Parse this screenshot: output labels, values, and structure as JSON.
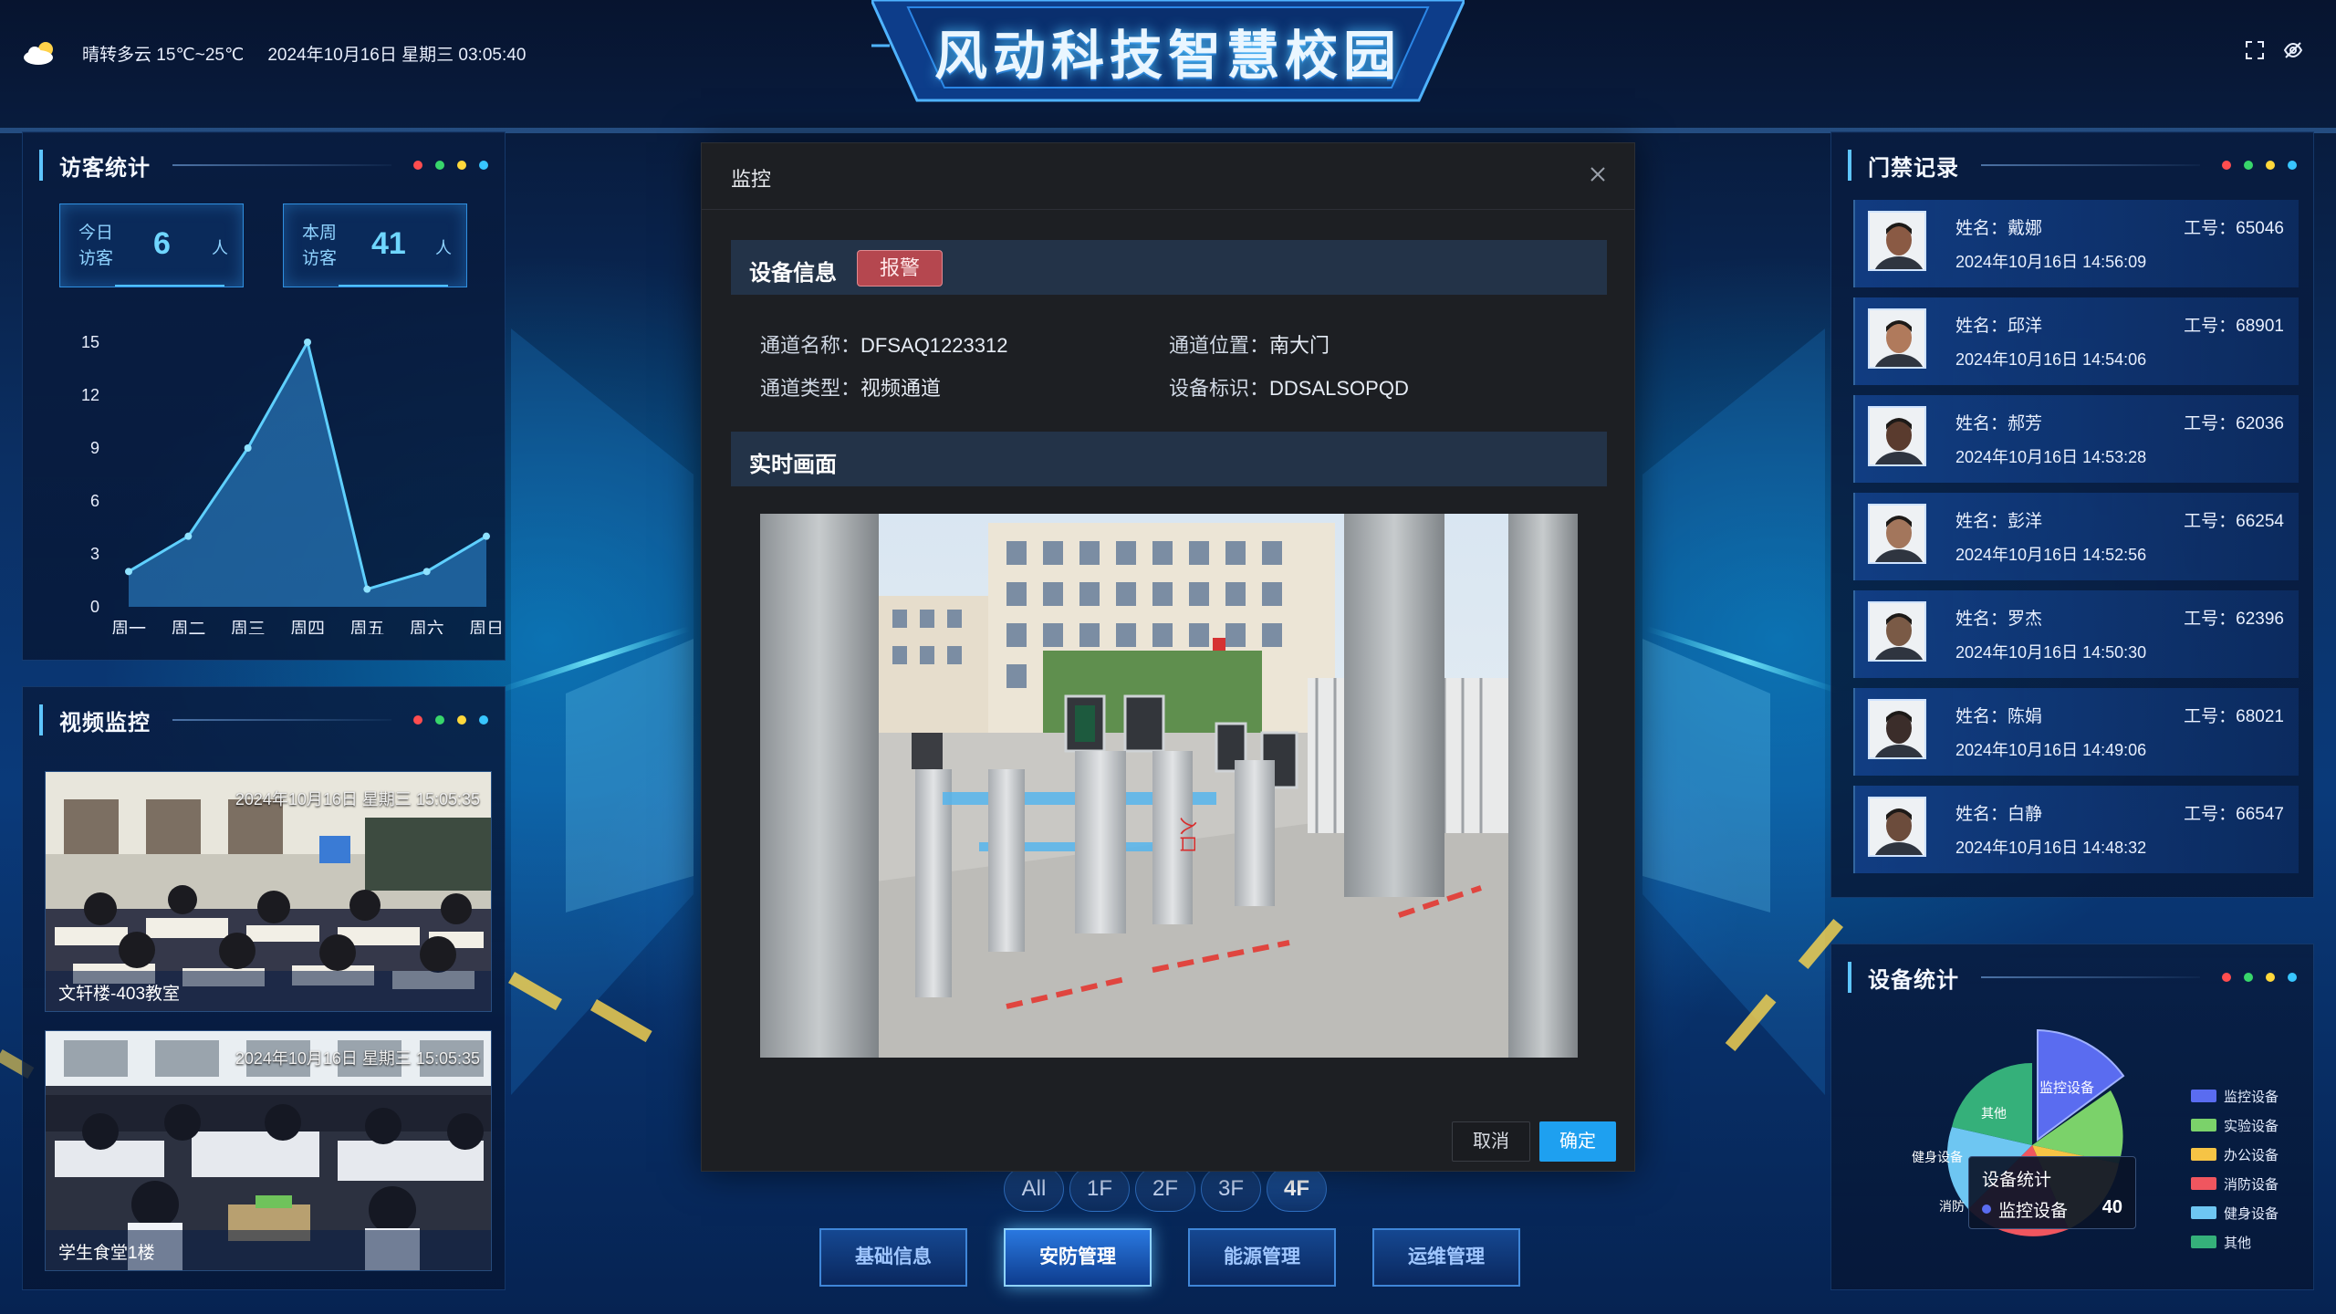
{
  "header": {
    "weather": "晴转多云 15℃~25℃",
    "datetime": "2024年10月16日 星期三 03:05:40",
    "title": "风动科技智慧校园"
  },
  "visitor_panel": {
    "title": "访客统计",
    "today": {
      "label": "今日访客",
      "value": "6",
      "unit": "人"
    },
    "week": {
      "label": "本周访客",
      "value": "41",
      "unit": "人"
    }
  },
  "chart_data": {
    "type": "area",
    "categories": [
      "周一",
      "周二",
      "周三",
      "周四",
      "周五",
      "周六",
      "周日"
    ],
    "values": [
      2,
      4,
      9,
      15,
      1,
      2,
      4
    ],
    "yticks": [
      "0",
      "3",
      "6",
      "9",
      "12",
      "15"
    ],
    "ylim": [
      0,
      15
    ],
    "title": "",
    "xlabel": "",
    "ylabel": ""
  },
  "video_panel": {
    "title": "视频监控",
    "feeds": [
      {
        "timestamp": "2024年10月16日 星期三 15:05:35",
        "caption": "文轩楼-403教室"
      },
      {
        "timestamp": "2024年10月16日 星期三 15:05:35",
        "caption": "学生食堂1楼"
      }
    ]
  },
  "access_panel": {
    "title": "门禁记录",
    "name_label": "姓名：",
    "id_label": "工号：",
    "records": [
      {
        "name": "戴娜",
        "id": "65046",
        "time": "2024年10月16日 14:56:09"
      },
      {
        "name": "邱洋",
        "id": "68901",
        "time": "2024年10月16日 14:54:06"
      },
      {
        "name": "郝芳",
        "id": "62036",
        "time": "2024年10月16日 14:53:28"
      },
      {
        "name": "彭洋",
        "id": "66254",
        "time": "2024年10月16日 14:52:56"
      },
      {
        "name": "罗杰",
        "id": "62396",
        "time": "2024年10月16日 14:50:30"
      },
      {
        "name": "陈娟",
        "id": "68021",
        "time": "2024年10月16日 14:49:06"
      },
      {
        "name": "白静",
        "id": "66547",
        "time": "2024年10月16日 14:48:32"
      }
    ]
  },
  "device_panel": {
    "title": "设备统计",
    "legend": [
      {
        "label": "监控设备",
        "color": "#5a6cf0"
      },
      {
        "label": "实验设备",
        "color": "#7bd26a"
      },
      {
        "label": "办公设备",
        "color": "#f6c445"
      },
      {
        "label": "消防设备",
        "color": "#f0565f"
      },
      {
        "label": "健身设备",
        "color": "#6ec6f2"
      },
      {
        "label": "其他",
        "color": "#35b07a"
      }
    ],
    "slice_labels": {
      "monitor": "监控设备",
      "other": "其他",
      "fitness": "健身设备",
      "fire": "消防"
    },
    "tooltip": {
      "title": "设备统计",
      "label": "监控设备",
      "value": "40"
    }
  },
  "floors": [
    "All",
    "1F",
    "2F",
    "3F",
    "4F"
  ],
  "active_floor": "4F",
  "nav": [
    "基础信息",
    "安防管理",
    "能源管理",
    "运维管理"
  ],
  "active_nav": "安防管理",
  "modal": {
    "title": "监控",
    "device_section": "设备信息",
    "status_badge": "报警",
    "fields": {
      "channel_name_label": "通道名称：",
      "channel_name": "DFSAQ1223312",
      "channel_location_label": "通道位置：",
      "channel_location": "南大门",
      "channel_type_label": "通道类型：",
      "channel_type": "视频通道",
      "device_id_label": "设备标识：",
      "device_id": "DDSALSOPQD"
    },
    "live_section": "实时画面",
    "gate_sign": "入口",
    "cancel": "取消",
    "confirm": "确定"
  },
  "colors": {
    "accent": "#1ea0f0",
    "alarm": "#b5474f",
    "dot_red": "#ff4d4f",
    "dot_green": "#38d66b",
    "dot_yellow": "#ffd83b",
    "dot_cyan": "#38c6ff"
  }
}
